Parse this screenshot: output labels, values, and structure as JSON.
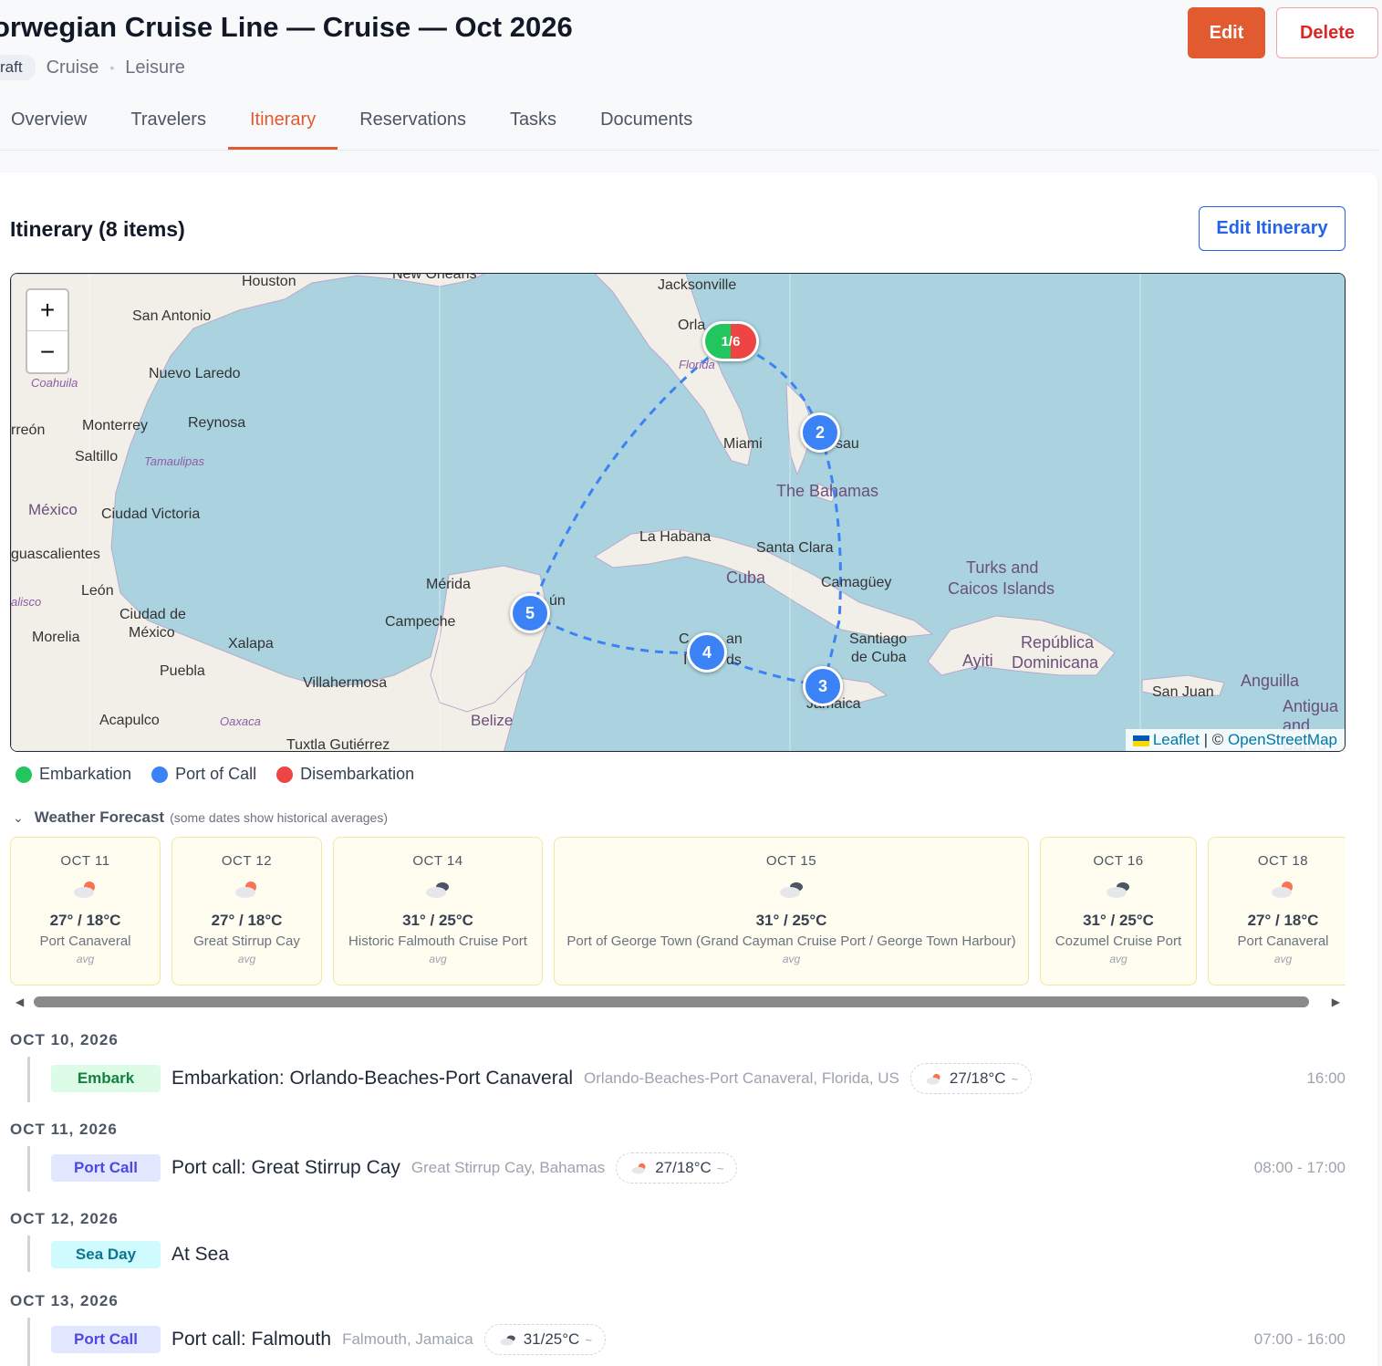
{
  "header": {
    "title": "orwegian Cruise Line — Cruise — Oct 2026",
    "status": "raft",
    "type": "Cruise",
    "category": "Leisure",
    "edit_label": "Edit",
    "delete_label": "Delete"
  },
  "tabs": [
    "Overview",
    "Travelers",
    "Itinerary",
    "Reservations",
    "Tasks",
    "Documents"
  ],
  "active_tab": "Itinerary",
  "itinerary": {
    "title": "Itinerary (8 items)",
    "edit_label": "Edit Itinerary"
  },
  "map": {
    "zoom_in": "+",
    "zoom_out": "−",
    "attribution_leaflet": "Leaflet",
    "attribution_sep": " | © ",
    "attribution_osm": "OpenStreetMap",
    "markers": [
      "1/6",
      "2",
      "3",
      "4",
      "5"
    ],
    "colors": {
      "water": "#aad3df",
      "land": "#f2efe9",
      "route": "#3b82f6",
      "embark": "#22c55e",
      "disembark": "#ef4444"
    },
    "labels": {
      "houston": "Houston",
      "new_orleans": "New Orleans",
      "jacksonville": "Jacksonville",
      "san_antonio": "San Antonio",
      "orlando": "Orla",
      "florida": "Florida",
      "nuevo_laredo": "Nuevo Laredo",
      "coahuila": "Coahuila",
      "monterrey": "Monterrey",
      "reynosa": "Reynosa",
      "torreon": "rreón",
      "saltillo": "Saltillo",
      "tamaulipas": "Tamaulipas",
      "mexico": "México",
      "ciudad_victoria": "Ciudad Victoria",
      "miami": "Miami",
      "nassau": "sau",
      "the_bahamas": "The Bahamas",
      "la_habana": "La Habana",
      "santa_clara": "Santa Clara",
      "cuba": "Cuba",
      "camaguey": "Camagüey",
      "turks": "Turks and",
      "caicos": "Caicos Islands",
      "aguascalientes": "guascalientes",
      "merida": "Mérida",
      "cancun": "ún",
      "leon": "León",
      "jalisco": "alisco",
      "ciudad_de": "Ciudad de",
      "mexico_city": "México",
      "campeche": "Campeche",
      "morelia": "Morelia",
      "xalapa": "Xalapa",
      "puebla": "Puebla",
      "cayman1": "C",
      "cayman2": "an",
      "cayman3": "I",
      "cayman4": "ds",
      "santiago": "Santiago",
      "de_cuba": "de Cuba",
      "ayiti": "Ayiti",
      "republica": "República",
      "dominicana": "Dominicana",
      "villahermosa": "Villahermosa",
      "jamaica": "Jamaica",
      "belize": "Belize",
      "san_juan": "San Juan",
      "anguilla": "Anguilla",
      "antigua": "Antigua",
      "barbu": "and Barbu",
      "acapulco": "Acapulco",
      "oaxaca": "Oaxaca",
      "tuxtla": "Tuxtla Gutiérrez"
    }
  },
  "legend": [
    {
      "label": "Embarkation",
      "color": "#22c55e"
    },
    {
      "label": "Port of Call",
      "color": "#3b82f6"
    },
    {
      "label": "Disembarkation",
      "color": "#ef4444"
    }
  ],
  "weather": {
    "title": "Weather Forecast",
    "subtitle": "(some dates show historical averages)",
    "cards": [
      {
        "date": "OCT 11",
        "temp": "27° / 18°C",
        "place": "Port Canaveral",
        "note": "avg",
        "icon": "partly-sunny-icon"
      },
      {
        "date": "OCT 12",
        "temp": "27° / 18°C",
        "place": "Great Stirrup Cay",
        "note": "avg",
        "icon": "partly-sunny-icon"
      },
      {
        "date": "OCT 14",
        "temp": "31° / 25°C",
        "place": "Historic Falmouth Cruise Port",
        "note": "avg",
        "icon": "cloudy-icon"
      },
      {
        "date": "OCT 15",
        "temp": "31° / 25°C",
        "place": "Port of George Town (Grand Cayman Cruise Port / George Town Harbour)",
        "note": "avg",
        "icon": "cloudy-icon"
      },
      {
        "date": "OCT 16",
        "temp": "31° / 25°C",
        "place": "Cozumel Cruise Port",
        "note": "avg",
        "icon": "cloudy-icon"
      },
      {
        "date": "OCT 18",
        "temp": "27° / 18°C",
        "place": "Port Canaveral",
        "note": "avg",
        "icon": "partly-sunny-icon"
      }
    ]
  },
  "days": [
    {
      "date": "OCT 10, 2026",
      "tag": "Embark",
      "name": "Embarkation: Orlando-Beaches-Port Canaveral",
      "location": "Orlando-Beaches-Port Canaveral, Florida, US",
      "weather": "27/18°C",
      "time": "16:00"
    },
    {
      "date": "OCT 11, 2026",
      "tag": "Port Call",
      "name": "Port call: Great Stirrup Cay",
      "location": "Great Stirrup Cay, Bahamas",
      "weather": "27/18°C",
      "time": "08:00 - 17:00"
    },
    {
      "date": "OCT 12, 2026",
      "tag": "Sea Day",
      "name": "At Sea",
      "location": "",
      "weather": "",
      "time": ""
    },
    {
      "date": "OCT 13, 2026",
      "tag": "Port Call",
      "name": "Port call: Falmouth",
      "location": "Falmouth, Jamaica",
      "weather": "31/25°C",
      "time": "07:00 - 16:00"
    }
  ],
  "approx": "~"
}
